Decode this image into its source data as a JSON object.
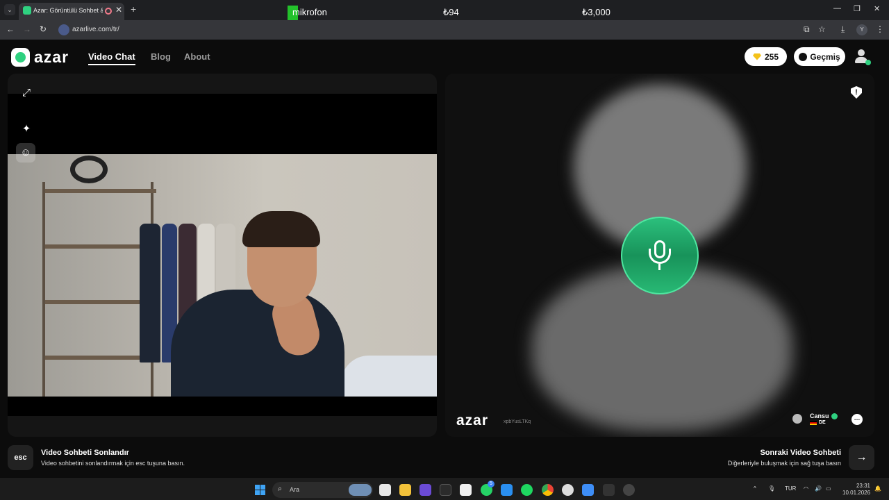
{
  "browser": {
    "tab_title": "Azar: Görüntülü Sohbet & V",
    "url": "azarlive.com/tr/",
    "profile_initial": "Y"
  },
  "overlay": {
    "mic_label": "mikrofon",
    "value_1": "₺94",
    "value_2": "₺3,000"
  },
  "header": {
    "brand": "azar",
    "nav": [
      "Video Chat",
      "Blog",
      "About"
    ],
    "gems": "255",
    "history_label": "Geçmiş"
  },
  "remote": {
    "watermark": "azar",
    "session_id": "xpbYusLTKq",
    "peer_name": "Cansu",
    "peer_country": "DE"
  },
  "hints": {
    "esc_key": "esc",
    "end_title": "Video Sohbeti Sonlandır",
    "end_desc": "Video sohbetini sonlandırmak için esc tuşuna basın.",
    "next_title": "Sonraki Video Sohbeti",
    "next_desc": "Diğerleriyle buluşmak için sağ tuşa basın"
  },
  "taskbar": {
    "search_placeholder": "Ara",
    "lang": "TUR",
    "time": "23:31",
    "date": "10.01.2026",
    "whatsapp_badge": "5"
  },
  "colors": {
    "accent": "#2fd180",
    "mic_button": "#1fa86a",
    "gem": "#f4c21a"
  },
  "icons": [
    "expand-icon",
    "sparkle-icon",
    "face-icon",
    "microphone-icon",
    "report-icon",
    "chat-icon",
    "arrow-right-icon"
  ]
}
